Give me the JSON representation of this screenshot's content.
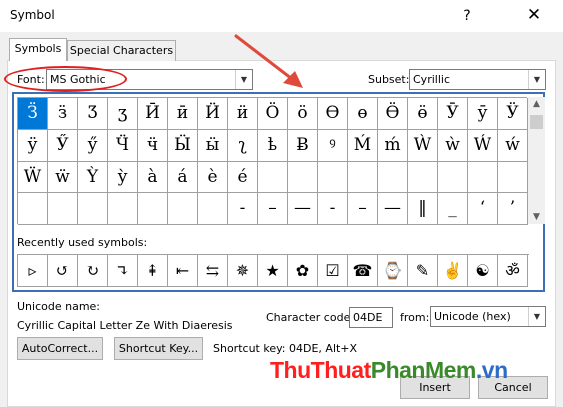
{
  "window": {
    "title": "Symbol",
    "help_glyph": "?",
    "close_glyph": "✕"
  },
  "tabs": [
    {
      "label": "Symbols",
      "underline": "S",
      "rest": "ymbols"
    },
    {
      "label": "Special Characters",
      "underline": "P",
      "pre": "S",
      "rest": "ecial Characters"
    }
  ],
  "font": {
    "label": "Font:",
    "value": "MS Gothic"
  },
  "subset": {
    "label": "Subset:",
    "value": "Cyrillic"
  },
  "grid_rows": [
    [
      "Ӟ",
      "ӟ",
      "Ӡ",
      "ӡ",
      "Ӣ",
      "ӣ",
      "Ӥ",
      "ӥ",
      "Ӧ",
      "ӧ",
      "Ө",
      "ө",
      "Ӫ",
      "ӫ",
      "Ӯ",
      "ӯ",
      "Ӱ"
    ],
    [
      "ӱ",
      "Ӳ",
      "ӳ",
      "Ӵ",
      "ӵ",
      "Ӹ",
      "ӹ",
      "ʅ",
      "ҍ",
      "Ƀ",
      "ꝰ",
      "Ḿ",
      "ḿ",
      "Ẁ",
      "ẁ",
      "Ẃ",
      "ẃ"
    ],
    [
      "Ẅ",
      "ẅ",
      "Ỳ",
      "ỳ",
      "à",
      "á",
      "è",
      "é",
      "",
      "",
      "",
      "",
      "",
      "",
      "",
      "",
      ""
    ],
    [
      "",
      "",
      "",
      "",
      "",
      "",
      "",
      "-",
      "–",
      "—",
      "-",
      "–",
      "—",
      "‖",
      "_",
      "‘",
      "’"
    ]
  ],
  "recent_label": "Recently used symbols:",
  "recent_symbols": [
    "▹",
    "↺",
    "↻",
    "↴",
    "⇞",
    "⇤",
    "⇆",
    "✵",
    "★",
    "✿",
    "☑",
    "☎",
    "⌚",
    "✎",
    "✌",
    "☯",
    "ॐ"
  ],
  "unicode_name_label": "Unicode name:",
  "unicode_name": "Cyrillic Capital Letter Ze With Diaeresis",
  "character_code": {
    "label": "Character code:",
    "value": "04DE"
  },
  "from": {
    "label": "from:",
    "value": "Unicode (hex)"
  },
  "buttons": {
    "autocorrect": "AutoCorrect...",
    "shortcut_key": "Shortcut Key...",
    "insert": "Insert",
    "cancel": "Cancel"
  },
  "shortcut_text": "Shortcut key: 04DE, Alt+X",
  "watermark": {
    "part1": "ThuThuat",
    "part2": "PhanMem",
    "part3": ".vn"
  },
  "colors": {
    "accent": "#0078d7",
    "highlight_red": "#e02020",
    "frame_blue": "#3b6fb6"
  }
}
